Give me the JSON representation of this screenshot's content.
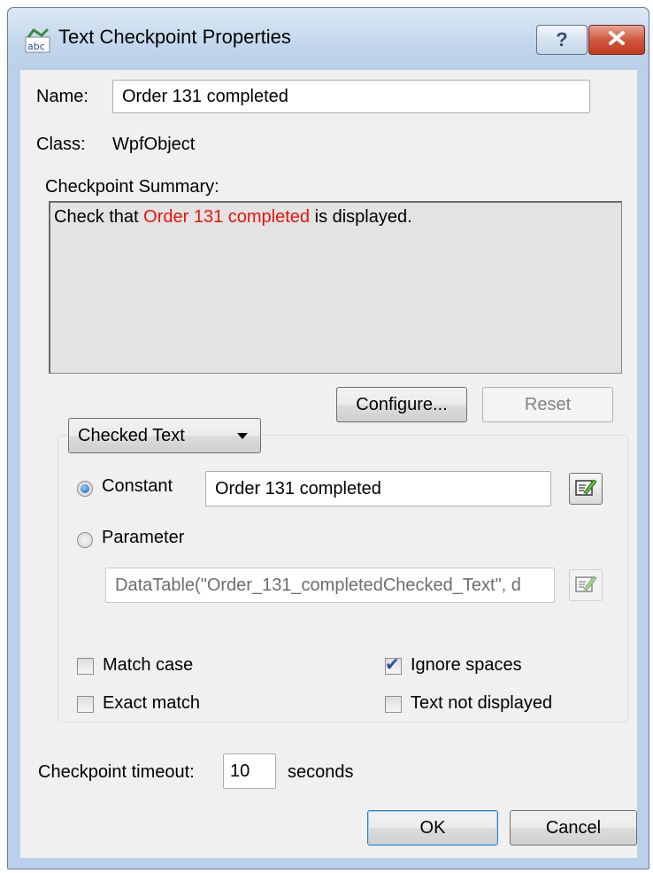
{
  "window": {
    "title": "Text Checkpoint Properties"
  },
  "fields": {
    "name_label": "Name:",
    "name_value": "Order 131 completed",
    "class_label": "Class:",
    "class_value": "WpfObject"
  },
  "summary": {
    "label": "Checkpoint Summary:",
    "prefix": "Check that ",
    "highlight": "Order 131 completed",
    "suffix": " is displayed.",
    "highlight_color": "#e8120f"
  },
  "buttons": {
    "configure": "Configure...",
    "reset": "Reset",
    "ok": "OK",
    "cancel": "Cancel"
  },
  "checked_text": {
    "dropdown_value": "Checked Text",
    "constant_label": "Constant",
    "constant_value": "Order 131 completed",
    "parameter_label": "Parameter",
    "parameter_value": "DataTable(\"Order_131_completedChecked_Text\", d",
    "selected": "Constant"
  },
  "options": {
    "match_case": {
      "label": "Match case",
      "checked": false
    },
    "exact_match": {
      "label": "Exact match",
      "checked": false
    },
    "ignore_spaces": {
      "label": "Ignore spaces",
      "checked": true
    },
    "text_not_displayed": {
      "label": "Text not displayed",
      "checked": false
    }
  },
  "timeout": {
    "label": "Checkpoint timeout:",
    "value": "10",
    "unit": "seconds"
  },
  "icons": [
    "abc-text-icon",
    "help-icon",
    "close-icon",
    "edit-value-icon",
    "dropdown-arrow-icon",
    "checkmark-icon"
  ]
}
